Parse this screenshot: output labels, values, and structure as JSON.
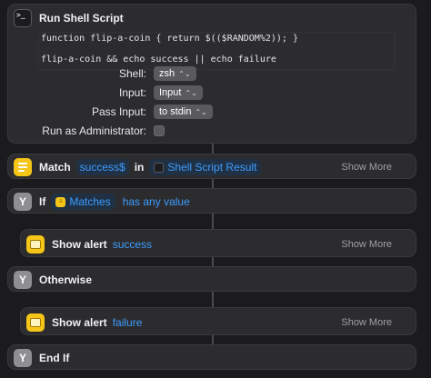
{
  "shell_script": {
    "title": "Run Shell Script",
    "code_line1": "function flip-a-coin { return $(($RANDOM%2)); }",
    "code_line2": "flip-a-coin && echo success || echo failure",
    "params": {
      "shell_label": "Shell:",
      "shell_value": "zsh",
      "input_label": "Input:",
      "input_value": "Input",
      "pass_input_label": "Pass Input:",
      "pass_input_value": "to stdin",
      "run_admin_label": "Run as Administrator:",
      "run_admin_checked": false
    }
  },
  "match": {
    "title": "Match",
    "pattern": "success$",
    "in_word": "in",
    "source": "Shell Script Result",
    "show_more": "Show More"
  },
  "if_block": {
    "title": "If",
    "variable": "Matches",
    "condition": "has any value"
  },
  "alert_success": {
    "title": "Show alert",
    "message": "success",
    "show_more": "Show More"
  },
  "otherwise": {
    "title": "Otherwise"
  },
  "alert_failure": {
    "title": "Show alert",
    "message": "failure",
    "show_more": "Show More"
  },
  "end_if": {
    "title": "End If"
  },
  "colors": {
    "background": "#1b1b1d",
    "card": "#2c2c2e",
    "accent_blue": "#3d9cff",
    "icon_yellow": "#f5c518",
    "icon_gray": "#8e8e93"
  }
}
